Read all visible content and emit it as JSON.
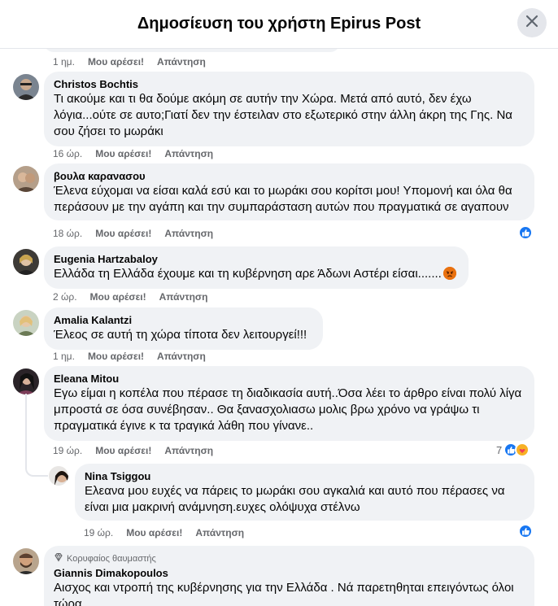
{
  "header": {
    "title": "Δημοσίευση του χρήστη Epirus Post",
    "close_icon": "close-icon"
  },
  "actions_common": {
    "like": "Μου αρέσει!",
    "reply": "Απάντηση"
  },
  "top_stub": {
    "time": "1 ημ."
  },
  "comments": [
    {
      "author": "Christos Bochtis",
      "text": "Τι ακούμε και τι θα δούμε ακόμη σε αυτήν την Χώρα. Μετά από αυτό, δεν έχω λόγια...ούτε σε αυτο;Γιατί δεν την έστειλαν στο εξωτερικό στην άλλη άκρη της Γης. Να σου ζήσει το μωράκι",
      "time": "16 ώρ."
    },
    {
      "author": "βουλα καρανασου",
      "text": "Έλενα εύχομαι να είσαι καλά εσύ και το μωράκι σου κορίτσι μου! Υπομονή και όλα θα περάσουν με την αγάπη και την συμπαράσταση αυτών που πραγματικά σε αγαπουν",
      "time": "18 ώρ."
    },
    {
      "author": "Eugenia Hartzabaloy",
      "text": "Ελλάδα τη Ελλάδα έχουμε και τη κυβέρνηση αρε Άδωνι Αστέρι είσαι.......",
      "time": "2 ώρ."
    },
    {
      "author": "Amalia Kalantzi",
      "text": "Έλεος σε αυτή τη χώρα τίποτα δεν λειτουργεί!!!",
      "time": "1 ημ."
    },
    {
      "author": "Eleana Mitou",
      "text": "Εγω είμαι η κοπέλα που πέρασε τη διαδικασία αυτή..Όσα λέει το άρθρο είναι πολύ λίγα μπροστά σε όσα συνέβησαν.. Θα ξανασχολιασω μολις βρω χρόνο να γράψω τι πραγματικά έγινε κ τα τραγικά λάθη που γίνανε..",
      "time": "19 ώρ.",
      "reaction_count": "7"
    },
    {
      "author": "Nina Tsiggou",
      "text": "Ελεανα μου ευχές να πάρεις το μωράκι σου αγκαλιά και αυτό που πέρασες να είναι μια μακρινή ανάμνηση.ευχες ολόψυχα στέλνω",
      "time": "19 ώρ."
    },
    {
      "author": "Giannis Dimakopoulos",
      "badge": "Κορυφαίος θαυμαστής",
      "text": "Αισχος και ντροπή της κυβέρνησης για την Ελλάδα . Νά παρετηθηται επειγόντως όλοι τώρα"
    }
  ],
  "colors": {
    "like_blue": "#1877f2",
    "bubble": "#f0f2f5",
    "meta": "#65676b"
  }
}
